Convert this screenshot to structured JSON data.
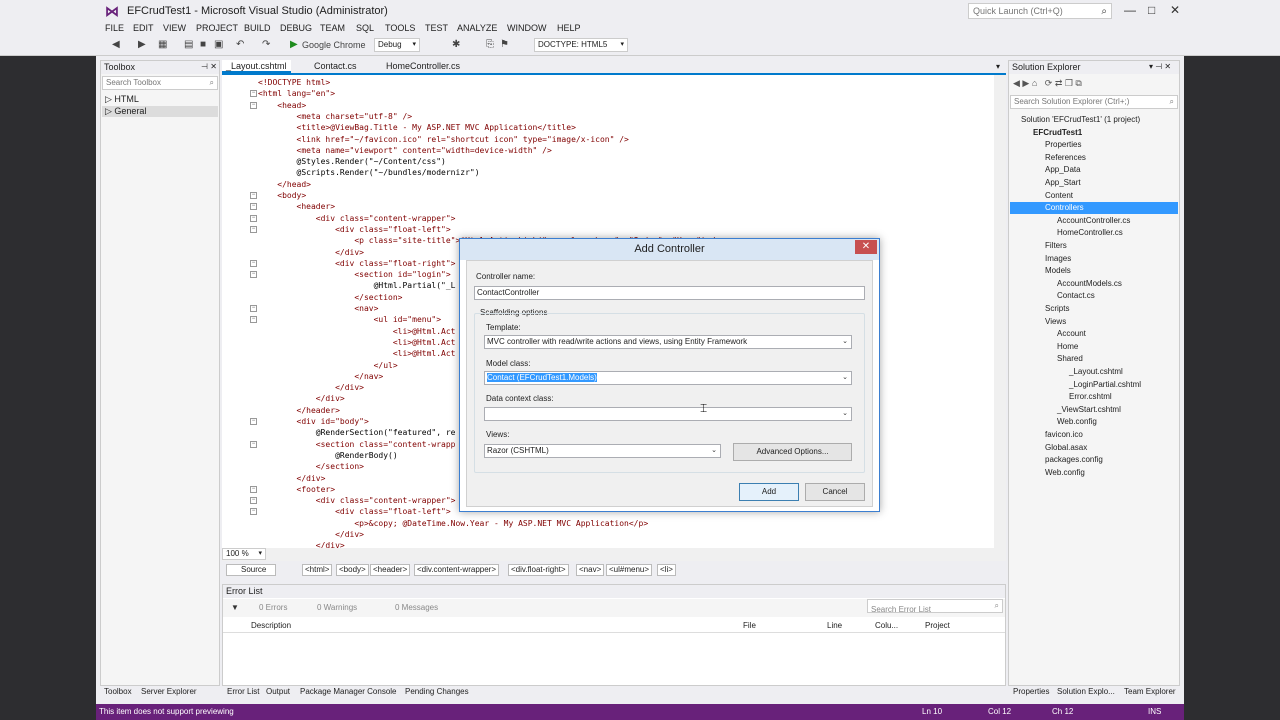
{
  "window": {
    "title": "EFCrudTest1 - Microsoft Visual Studio (Administrator)",
    "quick_launch_placeholder": "Quick Launch (Ctrl+Q)"
  },
  "menu": [
    "FILE",
    "EDIT",
    "VIEW",
    "PROJECT",
    "BUILD",
    "DEBUG",
    "TEAM",
    "SQL",
    "TOOLS",
    "TEST",
    "ANALYZE",
    "WINDOW",
    "HELP"
  ],
  "toolbar": {
    "browser": "Google Chrome",
    "config": "Debug",
    "doctype": "DOCTYPE: HTML5"
  },
  "toolbox": {
    "title": "Toolbox",
    "search": "Search Toolbox",
    "items": [
      "HTML",
      "General"
    ]
  },
  "editor": {
    "tabs": [
      "_Layout.cshtml",
      "Contact.cs",
      "HomeController.cs"
    ],
    "lines": [
      "<!DOCTYPE html>",
      "<html lang=\"en\">",
      "    <head>",
      "        <meta charset=\"utf-8\" />",
      "        <title>@ViewBag.Title - My ASP.NET MVC Application</title>",
      "        <link href=\"~/favicon.ico\" rel=\"shortcut icon\" type=\"image/x-icon\" />",
      "        <meta name=\"viewport\" content=\"width=device-width\" />",
      "        @Styles.Render(\"~/Content/css\")",
      "        @Scripts.Render(\"~/bundles/modernizr\")",
      "    </head>",
      "    <body>",
      "        <header>",
      "            <div class=\"content-wrapper\">",
      "                <div class=\"float-left\">",
      "                    <p class=\"site-title\">@Html.ActionLink(\"your logo here\", \"Index\", \"Home\")</p>",
      "                </div>",
      "                <div class=\"float-right\">",
      "                    <section id=\"login\">",
      "                        @Html.Partial(\"_L",
      "                    </section>",
      "                    <nav>",
      "                        <ul id=\"menu\">",
      "                            <li>@Html.Act",
      "                            <li>@Html.Act",
      "                            <li>@Html.Act",
      "                        </ul>",
      "                    </nav>",
      "                </div>",
      "            </div>",
      "        </header>",
      "        <div id=\"body\">",
      "            @RenderSection(\"featured\", re",
      "            <section class=\"content-wrapp",
      "                @RenderBody()",
      "            </section>",
      "        </div>",
      "        <footer>",
      "            <div class=\"content-wrapper\">",
      "                <div class=\"float-left\">",
      "                    <p>&copy; @DateTime.Now.Year - My ASP.NET MVC Application</p>",
      "                </div>",
      "            </div>",
      "        </footer>"
    ],
    "zoom": "100 %",
    "source_tab": "Source",
    "breadcrumbs": [
      "<html>",
      "<body>",
      "<header>",
      "<div.content-wrapper>",
      "<div.float-right>",
      "<nav>",
      "<ul#menu>",
      "<li>"
    ]
  },
  "error_list": {
    "title": "Error List",
    "errors": "0 Errors",
    "warnings": "0 Warnings",
    "messages": "0 Messages",
    "search": "Search Error List",
    "columns": [
      "Description",
      "File",
      "Line",
      "Colu...",
      "Project"
    ]
  },
  "bottom_tabs_left": [
    "Toolbox",
    "Server Explorer"
  ],
  "bottom_tabs_center": [
    "Error List",
    "Output",
    "Package Manager Console",
    "Pending Changes"
  ],
  "bottom_tabs_right": [
    "Properties",
    "Solution Explo...",
    "Team Explorer"
  ],
  "status": {
    "message": "This item does not support previewing",
    "ln": "Ln 10",
    "col": "Col 12",
    "ch": "Ch 12",
    "mode": "INS"
  },
  "solution_explorer": {
    "title": "Solution Explorer",
    "search": "Search Solution Explorer (Ctrl+;)",
    "items": [
      {
        "label": "Solution 'EFCrudTest1' (1 project)",
        "indent": 0,
        "bold": false
      },
      {
        "label": "EFCrudTest1",
        "indent": 1,
        "bold": true
      },
      {
        "label": "Properties",
        "indent": 2,
        "bold": false
      },
      {
        "label": "References",
        "indent": 2,
        "bold": false
      },
      {
        "label": "App_Data",
        "indent": 2,
        "bold": false
      },
      {
        "label": "App_Start",
        "indent": 2,
        "bold": false
      },
      {
        "label": "Content",
        "indent": 2,
        "bold": false
      },
      {
        "label": "Controllers",
        "indent": 2,
        "bold": false,
        "selected": true
      },
      {
        "label": "AccountController.cs",
        "indent": 3,
        "bold": false
      },
      {
        "label": "HomeController.cs",
        "indent": 3,
        "bold": false
      },
      {
        "label": "Filters",
        "indent": 2,
        "bold": false
      },
      {
        "label": "Images",
        "indent": 2,
        "bold": false
      },
      {
        "label": "Models",
        "indent": 2,
        "bold": false
      },
      {
        "label": "AccountModels.cs",
        "indent": 3,
        "bold": false
      },
      {
        "label": "Contact.cs",
        "indent": 3,
        "bold": false
      },
      {
        "label": "Scripts",
        "indent": 2,
        "bold": false
      },
      {
        "label": "Views",
        "indent": 2,
        "bold": false
      },
      {
        "label": "Account",
        "indent": 3,
        "bold": false
      },
      {
        "label": "Home",
        "indent": 3,
        "bold": false
      },
      {
        "label": "Shared",
        "indent": 3,
        "bold": false
      },
      {
        "label": "_Layout.cshtml",
        "indent": 4,
        "bold": false
      },
      {
        "label": "_LoginPartial.cshtml",
        "indent": 4,
        "bold": false
      },
      {
        "label": "Error.cshtml",
        "indent": 4,
        "bold": false
      },
      {
        "label": "_ViewStart.cshtml",
        "indent": 3,
        "bold": false
      },
      {
        "label": "Web.config",
        "indent": 3,
        "bold": false
      },
      {
        "label": "favicon.ico",
        "indent": 2,
        "bold": false
      },
      {
        "label": "Global.asax",
        "indent": 2,
        "bold": false
      },
      {
        "label": "packages.config",
        "indent": 2,
        "bold": false
      },
      {
        "label": "Web.config",
        "indent": 2,
        "bold": false
      }
    ]
  },
  "dialog": {
    "title": "Add Controller",
    "controller_name_label": "Controller name:",
    "controller_name_value": "ContactController",
    "scaffolding_label": "Scaffolding options",
    "template_label": "Template:",
    "template_value": "MVC controller with read/write actions and views, using Entity Framework",
    "model_class_label": "Model class:",
    "model_class_value": "Contact (EFCrudTest1.Models)",
    "data_context_label": "Data context class:",
    "data_context_value": "",
    "views_label": "Views:",
    "views_value": "Razor (CSHTML)",
    "advanced_button": "Advanced Options...",
    "add_button": "Add",
    "cancel_button": "Cancel"
  }
}
